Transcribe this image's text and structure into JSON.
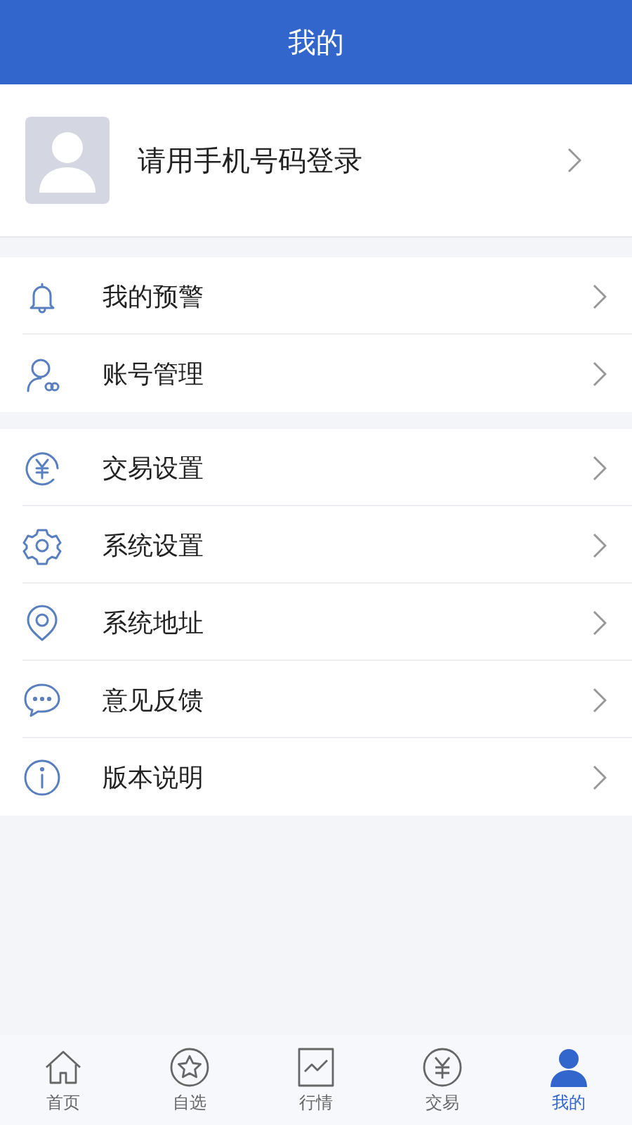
{
  "header": {
    "title": "我的"
  },
  "profile": {
    "login_prompt": "请用手机号码登录"
  },
  "groups": [
    {
      "items": [
        {
          "kind": "bell",
          "label": "我的预警"
        },
        {
          "kind": "account",
          "label": "账号管理"
        }
      ]
    },
    {
      "items": [
        {
          "kind": "yen",
          "label": "交易设置"
        },
        {
          "kind": "gear",
          "label": "系统设置"
        },
        {
          "kind": "pin",
          "label": "系统地址"
        },
        {
          "kind": "chat",
          "label": "意见反馈"
        },
        {
          "kind": "info",
          "label": "版本说明"
        }
      ]
    }
  ],
  "tab_bar": [
    {
      "kind": "home",
      "label": "首页",
      "selected": false
    },
    {
      "kind": "star",
      "label": "自选",
      "selected": false
    },
    {
      "kind": "chart",
      "label": "行情",
      "selected": false
    },
    {
      "kind": "yen",
      "label": "交易",
      "selected": false
    },
    {
      "kind": "person",
      "label": "我的",
      "selected": true
    }
  ]
}
